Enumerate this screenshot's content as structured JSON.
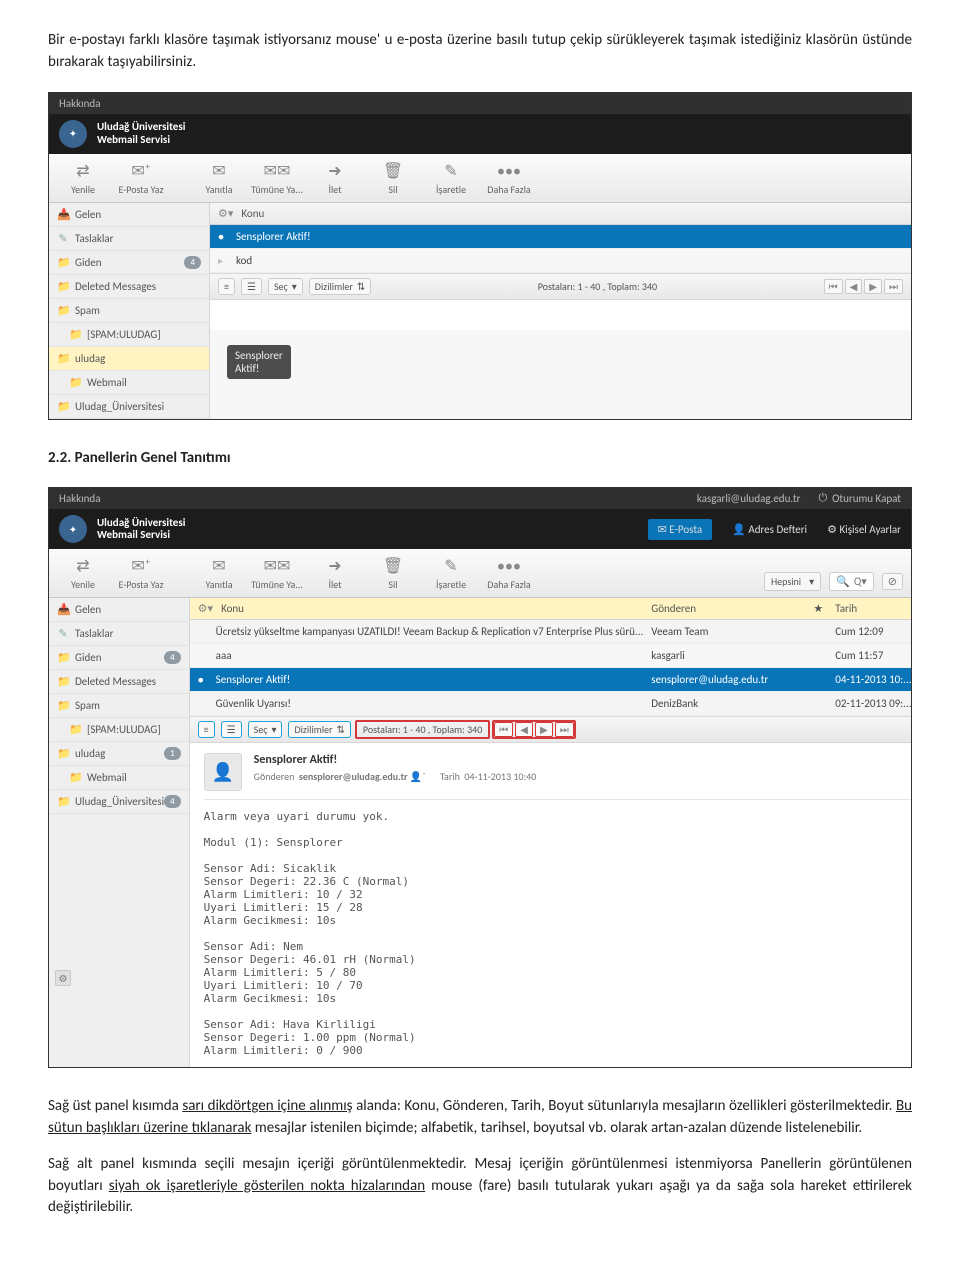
{
  "doc": {
    "p1": "Bir e-postayı farklı klasöre taşımak istiyorsanız mouse' u e-posta üzerine basılı tutup çekip sürükleyerek taşımak istediğiniz klasörün üstünde bırakarak taşıyabilirsiniz.",
    "section_num": "2.2.",
    "section_title": "Panellerin Genel Tanıtımı",
    "p2a": "Sağ üst panel kısımda ",
    "p2b": "sarı dikdörtgen içine alınmış",
    "p2c": " alanda: Konu, Gönderen, Tarih, Boyut sütunlarıyla mesajların özellikleri gösterilmektedir. ",
    "p2d": "Bu sütun başlıkları üzerine tıklanarak",
    "p2e": " mesajlar istenilen biçimde; alfabetik, tarihsel, boyutsal vb. olarak artan-azalan düzende listelenebilir.",
    "p3a": "Sağ alt panel kısmında seçili mesajın içeriği görüntülenmektedir. Mesaj içeriğin görüntülenmesi istenmiyorsa Panellerin görüntülenen boyutları ",
    "p3b": "siyah ok işaretleriyle gösterilen nokta hizalarından",
    "p3c": " mouse (fare) basılı tutularak yukarı aşağı ya da sağa sola hareket ettirilerek değiştirilebilir."
  },
  "app": {
    "about": "Hakkında",
    "brand1": "Uludağ Üniversitesi",
    "brand2": "Webmail Servisi",
    "user": "kasgarli@uludag.edu.tr",
    "logout": "Oturumu Kapat",
    "nav_mail": "E-Posta",
    "nav_contacts": "Adres Defteri",
    "nav_settings": "Kişisel Ayarlar"
  },
  "tb": {
    "refresh": "Yenile",
    "compose": "E-Posta Yaz",
    "reply": "Yanıtla",
    "replyall": "Tümüne Ya...",
    "forward": "İlet",
    "delete": "Sil",
    "mark": "İşaretle",
    "more": "Daha Fazla",
    "filter": "Hepsini",
    "search_hint": "Q▾"
  },
  "folders": {
    "inbox": "Gelen",
    "drafts": "Taslaklar",
    "sent": "Giden",
    "deleted": "Deleted Messages",
    "spam": "Spam",
    "spam_sub": "[SPAM:ULUDAG]",
    "uludag": "uludag",
    "webmail": "Webmail",
    "uuniv": "Uludag_Üniversitesi",
    "badge_sent": "4",
    "badge_uludag": "1",
    "badge_uuniv": "4"
  },
  "list": {
    "gear": "⚙",
    "conf": "Seç",
    "sort": "Dizilimler",
    "status": "Postaları: 1 - 40 , Toplam: 340",
    "col_subject": "Konu",
    "col_from": "Gönderen",
    "col_star": "★",
    "col_date": "Tarih"
  },
  "shot1": {
    "r1_sub": "Sensplorer Aktif!",
    "r2_sub": "kod",
    "tooltip": "Sensplorer Aktif!"
  },
  "shot2": {
    "r1_sub": "Ücretsiz yükseltme kampanyası UZATILDI! Veeam Backup & Replication v7 Enterprise Plus sürü...",
    "r1_from": "Veeam Team",
    "r1_date": "Cum 12:09",
    "r2_sub": "aaa",
    "r2_from": "kasgarli",
    "r2_date": "Cum 11:57",
    "r3_sub": "Sensplorer Aktif!",
    "r3_from": "sensplorer@uludag.edu.tr",
    "r3_date": "04-11-2013 10:...",
    "r4_sub": "Güvenlik Uyarısı!",
    "r4_from": "DenizBank",
    "r4_date": "02-11-2013 09:..."
  },
  "preview": {
    "subject": "Sensplorer Aktif!",
    "from_label": "Gönderen",
    "from_val": "sensplorer@uludag.edu.tr",
    "date_label": "Tarih",
    "date_val": "04-11-2013 10:40",
    "l0": "Alarm veya uyari durumu yok.",
    "l1": "Modul (1): Sensplorer",
    "l2": "Sensor Adi: Sicaklik",
    "l3": "Sensor Degeri: 22.36 C (Normal)",
    "l4": "Alarm Limitleri: 10 / 32",
    "l5": "Uyari Limitleri: 15 / 28",
    "l6": "Alarm Gecikmesi: 10s",
    "l7": "Sensor Adi: Nem",
    "l8": "Sensor Degeri: 46.01 rH (Normal)",
    "l9": "Alarm Limitleri: 5 / 80",
    "l10": "Uyari Limitleri: 10 / 70",
    "l11": "Alarm Gecikmesi: 10s",
    "l12": "Sensor Adi: Hava Kirliligi",
    "l13": "Sensor Degeri: 1.00 ppm (Normal)",
    "l14": "Alarm Limitleri: 0 / 900"
  }
}
